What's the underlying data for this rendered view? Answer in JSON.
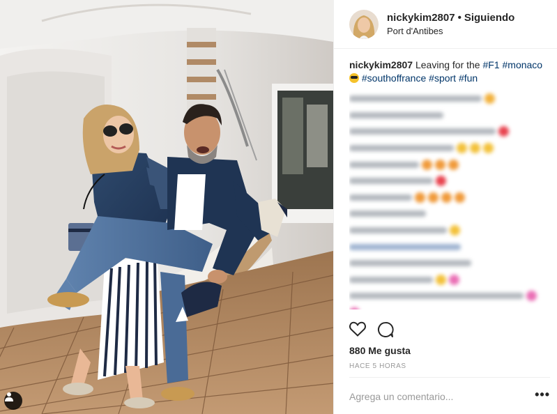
{
  "header": {
    "username": "nickykim2807",
    "separator": "•",
    "follow_status": "Siguiendo",
    "location": "Port d'Antibes"
  },
  "caption": {
    "username": "nickykim2807",
    "text": "Leaving for the",
    "hashtags_line1": [
      "#F1",
      "#monaco"
    ],
    "hashtags_line2": [
      "#southoffrance",
      "#sport",
      "#fun"
    ],
    "emoji": "sunglasses-emoji"
  },
  "actions": {
    "like_icon": "heart-icon",
    "comment_icon": "comment-icon"
  },
  "likes": "880 Me gusta",
  "timestamp": "HACE 5 HORAS",
  "comment_input": {
    "placeholder": "Agrega un comentario..."
  },
  "more_options": "•••",
  "photo": {
    "tag_icon": "user-tag-icon"
  },
  "colors": {
    "hashtag": "#003569",
    "muted": "#999999",
    "text": "#262626"
  }
}
